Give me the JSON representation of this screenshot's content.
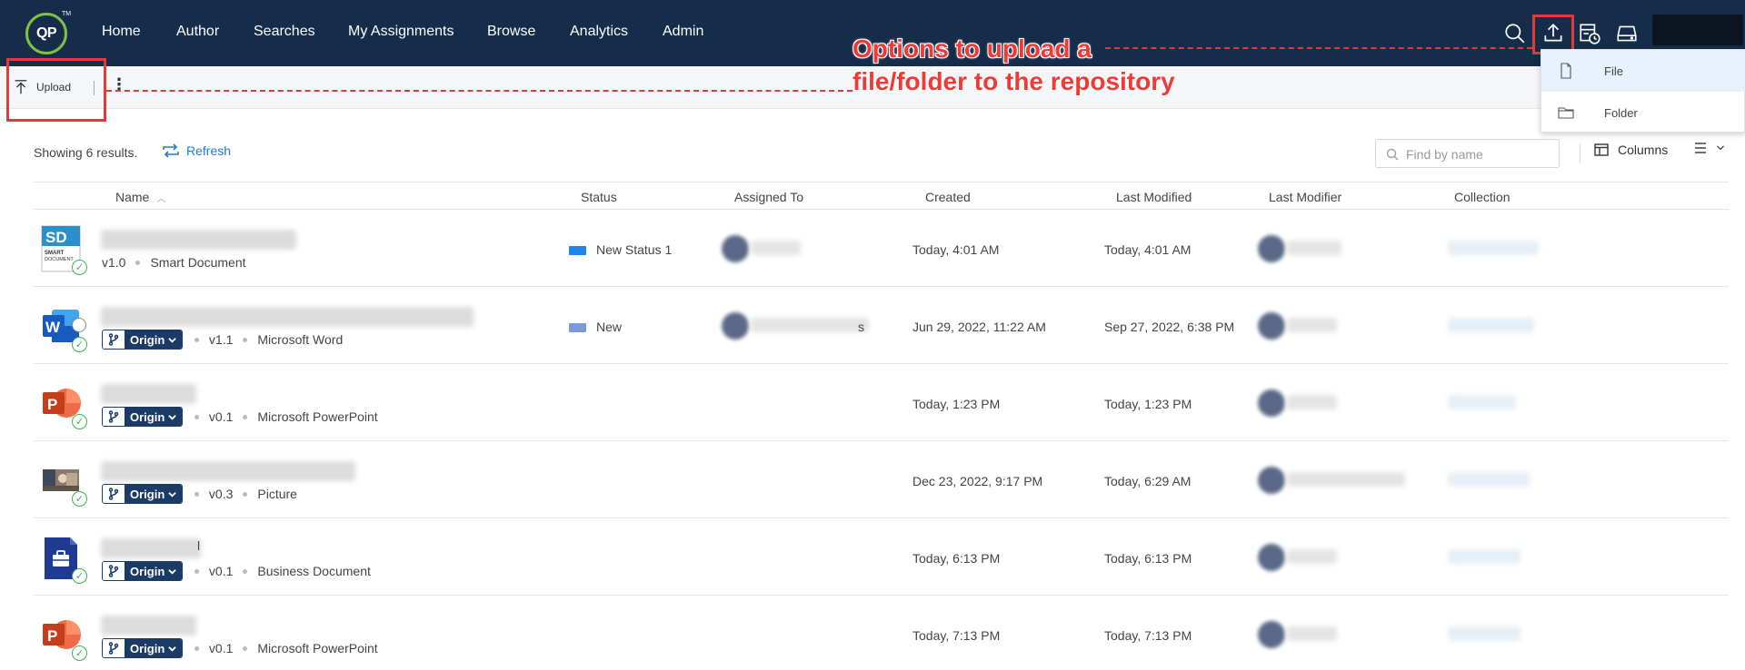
{
  "nav": {
    "logo": "QP",
    "logo_tm": "TM",
    "items": [
      "Home",
      "Author",
      "Searches",
      "My Assignments",
      "Browse",
      "Analytics",
      "Admin"
    ],
    "icons": [
      "search-icon",
      "upload-icon",
      "scheduled-task-icon",
      "drive-icon"
    ]
  },
  "toolbar": {
    "upload_label": "Upload",
    "more_label": "⋮"
  },
  "annotation": {
    "line1": "Options to upload a",
    "line2": "file/folder to the repository"
  },
  "upload_menu": {
    "items": [
      "File",
      "Folder"
    ]
  },
  "results": {
    "count_text": "Showing 6 results.",
    "refresh_label": "Refresh"
  },
  "search": {
    "placeholder": "Find by name"
  },
  "columns_label": "Columns",
  "table": {
    "headers": [
      "Name",
      "Status",
      "Assigned To",
      "Created",
      "Last Modified",
      "Last Modifier",
      "Collection"
    ],
    "rows": [
      {
        "icon": "smart-document-icon",
        "origin": "",
        "version": "v1.0",
        "type": "Smart Document",
        "status": "New Status 1",
        "status_color": "#1d86e6",
        "created": "Today, 4:01 AM",
        "modified": "Today, 4:01 AM"
      },
      {
        "icon": "word-icon",
        "origin": "Origin",
        "version": "v1.1",
        "type": "Microsoft Word",
        "status": "New",
        "status_color": "#7a9ad6",
        "assigned_suffix": "s",
        "created": "Jun 29, 2022, 11:22 AM",
        "modified": "Sep 27, 2022, 6:38 PM"
      },
      {
        "icon": "powerpoint-icon",
        "origin": "Origin",
        "version": "v0.1",
        "type": "Microsoft PowerPoint",
        "status": "",
        "created": "Today, 1:23 PM",
        "modified": "Today, 1:23 PM"
      },
      {
        "icon": "picture-icon",
        "origin": "Origin",
        "version": "v0.3",
        "type": "Picture",
        "status": "",
        "created": "Dec 23, 2022, 9:17 PM",
        "modified": "Today, 6:29 AM"
      },
      {
        "icon": "business-document-icon",
        "origin": "Origin",
        "version": "v0.1",
        "type": "Business Document",
        "status": "",
        "name_fragment": "l",
        "created": "Today, 6:13 PM",
        "modified": "Today, 6:13 PM"
      },
      {
        "icon": "powerpoint-icon",
        "origin": "Origin",
        "version": "v0.1",
        "type": "Microsoft PowerPoint",
        "status": "",
        "created": "Today, 7:13 PM",
        "modified": "Today, 7:13 PM"
      }
    ]
  },
  "colors": {
    "nav_bg": "#152c4a",
    "accent_green": "#7ec242",
    "link_blue": "#1e7bd8",
    "annotation_red": "#e03a3a",
    "origin_navy": "#1b3a66"
  }
}
